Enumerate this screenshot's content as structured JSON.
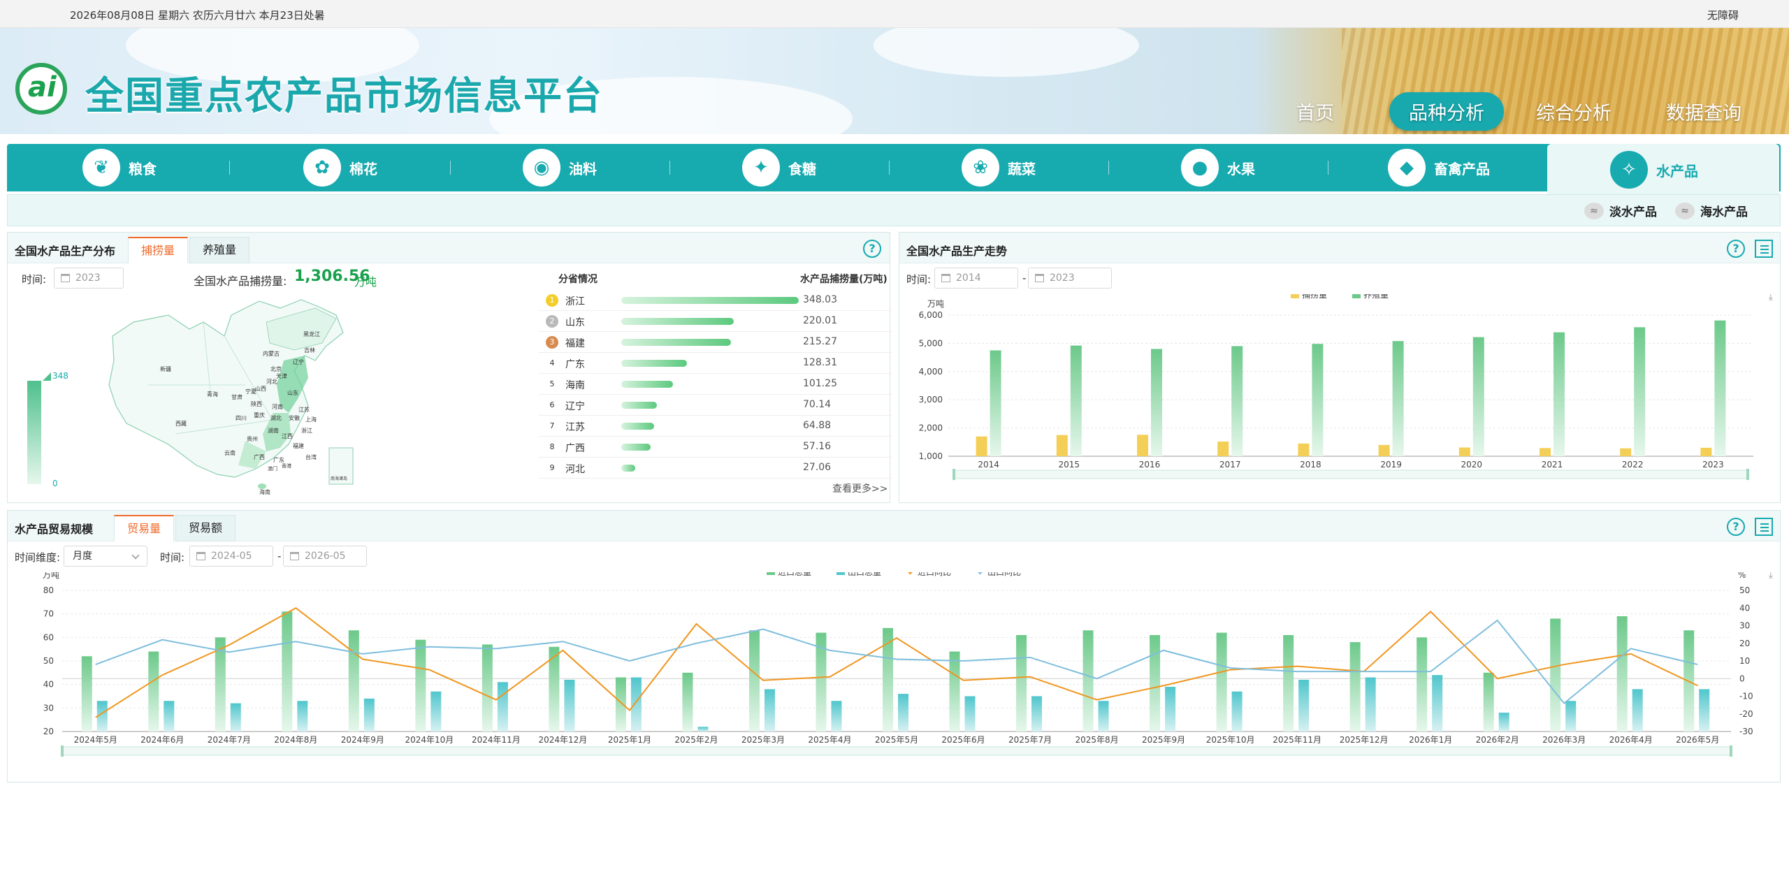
{
  "topbar": {
    "date": "2026年08月08日 星期六 农历六月廿六 本月23日处暑",
    "accessibility": "无障碍"
  },
  "header": {
    "logo_text": "ai",
    "title": "全国重点农产品市场信息平台",
    "nav": [
      "首页",
      "品种分析",
      "综合分析",
      "数据查询"
    ],
    "active_nav": "品种分析"
  },
  "categories": [
    {
      "label": "粮食",
      "icon": "grain-icon"
    },
    {
      "label": "棉花",
      "icon": "cotton-icon"
    },
    {
      "label": "油料",
      "icon": "oil-drop-icon"
    },
    {
      "label": "食糖",
      "icon": "sugar-icon"
    },
    {
      "label": "蔬菜",
      "icon": "vegetable-icon"
    },
    {
      "label": "水果",
      "icon": "fruit-icon"
    },
    {
      "label": "畜禽产品",
      "icon": "meat-icon"
    },
    {
      "label": "水产品",
      "icon": "fish-icon"
    }
  ],
  "active_category": "水产品",
  "subcategories": [
    "淡水产品",
    "海水产品"
  ],
  "distribution": {
    "title": "全国水产品生产分布",
    "tabs": [
      "捕捞量",
      "养殖量"
    ],
    "time_label": "时间:",
    "year": "2023",
    "total_label": "全国水产品捕捞量:",
    "total_value": "1,306.56",
    "total_unit": "万吨",
    "legend_max": "348",
    "legend_min": "0",
    "map_labels": [
      "黑龙江",
      "吉林",
      "辽宁",
      "内蒙古",
      "北京",
      "天津",
      "河北",
      "山西",
      "山东",
      "新疆",
      "青海",
      "西藏",
      "甘肃",
      "宁夏",
      "陕西",
      "河南",
      "江苏",
      "安徽",
      "上海",
      "湖北",
      "四川",
      "重庆",
      "浙江",
      "湖南",
      "江西",
      "贵州",
      "福建",
      "云南",
      "广西",
      "广东",
      "台湾",
      "海南",
      "香港",
      "澳门",
      "南海诸岛"
    ],
    "rank_header": [
      "分省情况",
      "水产品捕捞量(万吨)"
    ],
    "ranking": [
      {
        "rank": "1",
        "province": "浙江",
        "value": "348.03",
        "num": 348.03
      },
      {
        "rank": "2",
        "province": "山东",
        "value": "220.01",
        "num": 220.01
      },
      {
        "rank": "3",
        "province": "福建",
        "value": "215.27",
        "num": 215.27
      },
      {
        "rank": "4",
        "province": "广东",
        "value": "128.31",
        "num": 128.31
      },
      {
        "rank": "5",
        "province": "海南",
        "value": "101.25",
        "num": 101.25
      },
      {
        "rank": "6",
        "province": "辽宁",
        "value": "70.14",
        "num": 70.14
      },
      {
        "rank": "7",
        "province": "江苏",
        "value": "64.88",
        "num": 64.88
      },
      {
        "rank": "8",
        "province": "广西",
        "value": "57.16",
        "num": 57.16
      },
      {
        "rank": "9",
        "province": "河北",
        "value": "27.06",
        "num": 27.06
      }
    ],
    "more": "查看更多>>"
  },
  "trend": {
    "title": "全国水产品生产走势",
    "time_label": "时间:",
    "start": "2014",
    "end": "2023",
    "dash": "-"
  },
  "trade": {
    "title": "水产品贸易规模",
    "tabs": [
      "贸易量",
      "贸易额"
    ],
    "dimension_label": "时间维度:",
    "dimension_value": "月度",
    "time_label": "时间:",
    "start": "2024-05",
    "end": "2026-05",
    "dash": "-"
  },
  "colors": {
    "teal": "#17aaaf",
    "green": "#6cc98a",
    "yellow": "#f4cf57",
    "cyan": "#4fc6cc",
    "orange": "#f0961f",
    "blue": "#7fbedd",
    "tab_active": "#f06a2a"
  },
  "chart_data": [
    {
      "type": "bar",
      "title": "",
      "ylabel": "万吨",
      "categories": [
        "2014",
        "2015",
        "2016",
        "2017",
        "2018",
        "2019",
        "2020",
        "2021",
        "2022",
        "2023"
      ],
      "series": [
        {
          "name": "捕捞量",
          "values": [
            1700,
            1750,
            1760,
            1520,
            1450,
            1400,
            1310,
            1290,
            1280,
            1300
          ]
        },
        {
          "name": "养殖量",
          "values": [
            4750,
            4920,
            4800,
            4900,
            4980,
            5080,
            5220,
            5390,
            5570,
            5810
          ]
        }
      ],
      "ylim": [
        1000,
        6000
      ],
      "yticks": [
        "1,000",
        "2,000",
        "3,000",
        "4,000",
        "5,000",
        "6,000"
      ],
      "legend": "top-center",
      "grid": true
    },
    {
      "type": "bar",
      "title": "",
      "ylabel": "万吨",
      "y2label": "%",
      "categories": [
        "2024年5月",
        "2024年6月",
        "2024年7月",
        "2024年8月",
        "2024年9月",
        "2024年10月",
        "2024年11月",
        "2024年12月",
        "2025年1月",
        "2025年2月",
        "2025年3月",
        "2025年4月",
        "2025年5月",
        "2025年6月",
        "2025年7月",
        "2025年8月",
        "2025年9月",
        "2025年10月",
        "2025年11月",
        "2025年12月",
        "2026年1月",
        "2026年2月",
        "2026年3月",
        "2026年4月",
        "2026年5月"
      ],
      "series": [
        {
          "name": "进口总量",
          "kind": "bar",
          "axis": "left",
          "values": [
            52,
            54,
            60,
            71,
            63,
            59,
            57,
            56,
            43,
            45,
            63,
            62,
            64,
            54,
            61,
            63,
            61,
            62,
            61,
            58,
            60,
            45,
            68,
            69,
            63
          ]
        },
        {
          "name": "出口总量",
          "kind": "bar",
          "axis": "left",
          "values": [
            33,
            33,
            32,
            33,
            34,
            37,
            41,
            42,
            43,
            22,
            38,
            33,
            36,
            35,
            35,
            33,
            39,
            37,
            42,
            43,
            44,
            28,
            33,
            38,
            38
          ]
        },
        {
          "name": "进口同比",
          "kind": "line",
          "axis": "right",
          "values": [
            -22,
            2,
            19,
            40,
            11,
            5,
            -12,
            16,
            -18,
            31,
            -1,
            1,
            23,
            -1,
            1,
            -12,
            -4,
            5,
            7,
            4,
            38,
            0,
            8,
            14,
            -4
          ]
        },
        {
          "name": "出口同比",
          "kind": "line",
          "axis": "right",
          "values": [
            8,
            22,
            15,
            21,
            14,
            18,
            17,
            21,
            10,
            20,
            28,
            16,
            11,
            10,
            12,
            0,
            16,
            6,
            4,
            4,
            4,
            33,
            -14,
            17,
            8
          ]
        }
      ],
      "ylim": [
        20,
        80
      ],
      "y2lim": [
        -30,
        50
      ],
      "legend": "top-center",
      "grid": true
    }
  ]
}
